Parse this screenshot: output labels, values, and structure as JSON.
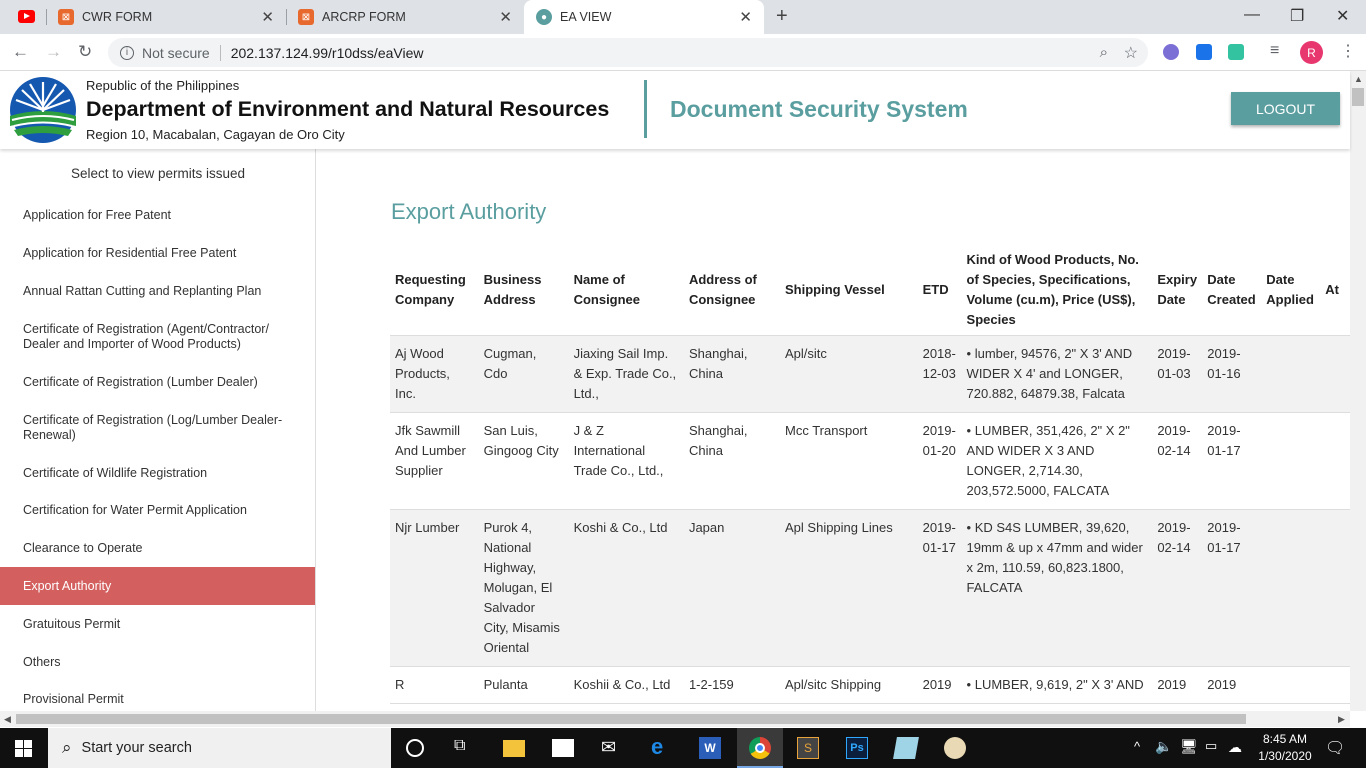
{
  "browser": {
    "tabs": [
      {
        "label": "CWR FORM"
      },
      {
        "label": "ARCRP FORM"
      },
      {
        "label": "EA VIEW"
      }
    ],
    "security": "Not secure",
    "url": "202.137.124.99/r10dss/eaView",
    "profile_initial": "R"
  },
  "header": {
    "republic": "Republic of the Philippines",
    "department": "Department of Environment and Natural Resources",
    "region": "Region 10, Macabalan, Cagayan de Oro City",
    "system": "Document Security System",
    "logout": "LOGOUT"
  },
  "sidebar": {
    "title": "Select to view permits issued",
    "items": [
      {
        "label": "Application for Free Patent"
      },
      {
        "label": "Application for Residential Free Patent"
      },
      {
        "label": "Annual Rattan Cutting and Replanting Plan"
      },
      {
        "label": "Certificate of Registration (Agent/Contractor/ Dealer and Importer of Wood Products)"
      },
      {
        "label": "Certificate of Registration (Lumber Dealer)"
      },
      {
        "label": "Certificate of Registration (Log/Lumber Dealer- Renewal)"
      },
      {
        "label": "Certificate of Wildlife Registration"
      },
      {
        "label": "Certification for Water Permit Application"
      },
      {
        "label": "Clearance to Operate"
      },
      {
        "label": "Export Authority"
      },
      {
        "label": "Gratuitous Permit"
      },
      {
        "label": "Others"
      },
      {
        "label": "Provisional Permit"
      }
    ],
    "active_index": 9
  },
  "main": {
    "title": "Export Authority",
    "columns": [
      "Requesting Company",
      "Business Address",
      "Name of Consignee",
      "Address of Consignee",
      "Shipping Vessel",
      "ETD",
      "Kind of Wood Products, No. of Species, Specifications, Volume (cu.m), Price (US$), Species",
      "Expiry Date",
      "Date Created",
      "Date Applied",
      "At"
    ],
    "rows": [
      {
        "company": "Aj Wood Products, Inc.",
        "business_address": "Cugman, Cdo",
        "consignee": "Jiaxing Sail Imp. & Exp. Trade Co., Ltd.,",
        "consignee_address": "Shanghai, China",
        "vessel": "Apl/sitc",
        "etd": "2018-12-03",
        "products": "• lumber, 94576, 2\" X 3' AND WIDER X 4' and LONGER, 720.882, 64879.38, Falcata",
        "expiry": "2019-01-03",
        "created": "2019-01-16",
        "applied": ""
      },
      {
        "company": "Jfk Sawmill And Lumber Supplier",
        "business_address": "San Luis, Gingoog City",
        "consignee": "J & Z International Trade Co., Ltd.,",
        "consignee_address": "Shanghai, China",
        "vessel": "Mcc Transport",
        "etd": "2019-01-20",
        "products": "• LUMBER, 351,426, 2\" X 2\" AND WIDER X 3 AND LONGER, 2,714.30, 203,572.5000, FALCATA",
        "expiry": "2019-02-14",
        "created": "2019-01-17",
        "applied": ""
      },
      {
        "company": "Njr Lumber",
        "business_address": "Purok 4, National Highway, Molugan, El Salvador City, Misamis Oriental",
        "consignee": "Koshi & Co., Ltd",
        "consignee_address": "Japan",
        "vessel": "Apl Shipping Lines",
        "etd": "2019-01-17",
        "products": "• KD S4S LUMBER, 39,620, 19mm & up x 47mm and wider x 2m, 110.59, 60,823.1800, FALCATA",
        "expiry": "2019-02-14",
        "created": "2019-01-17",
        "applied": ""
      },
      {
        "company": "R",
        "business_address": "Pulanta",
        "consignee": "Koshii & Co., Ltd",
        "consignee_address": "1-2-159",
        "vessel": "Apl/sitc Shipping",
        "etd": "2019",
        "products": "• LUMBER, 9,619, 2\" X 3' AND",
        "expiry": "2019",
        "created": "2019",
        "applied": ""
      }
    ]
  },
  "taskbar": {
    "search_placeholder": "Start your search",
    "time": "8:45 AM",
    "date": "1/30/2020"
  }
}
